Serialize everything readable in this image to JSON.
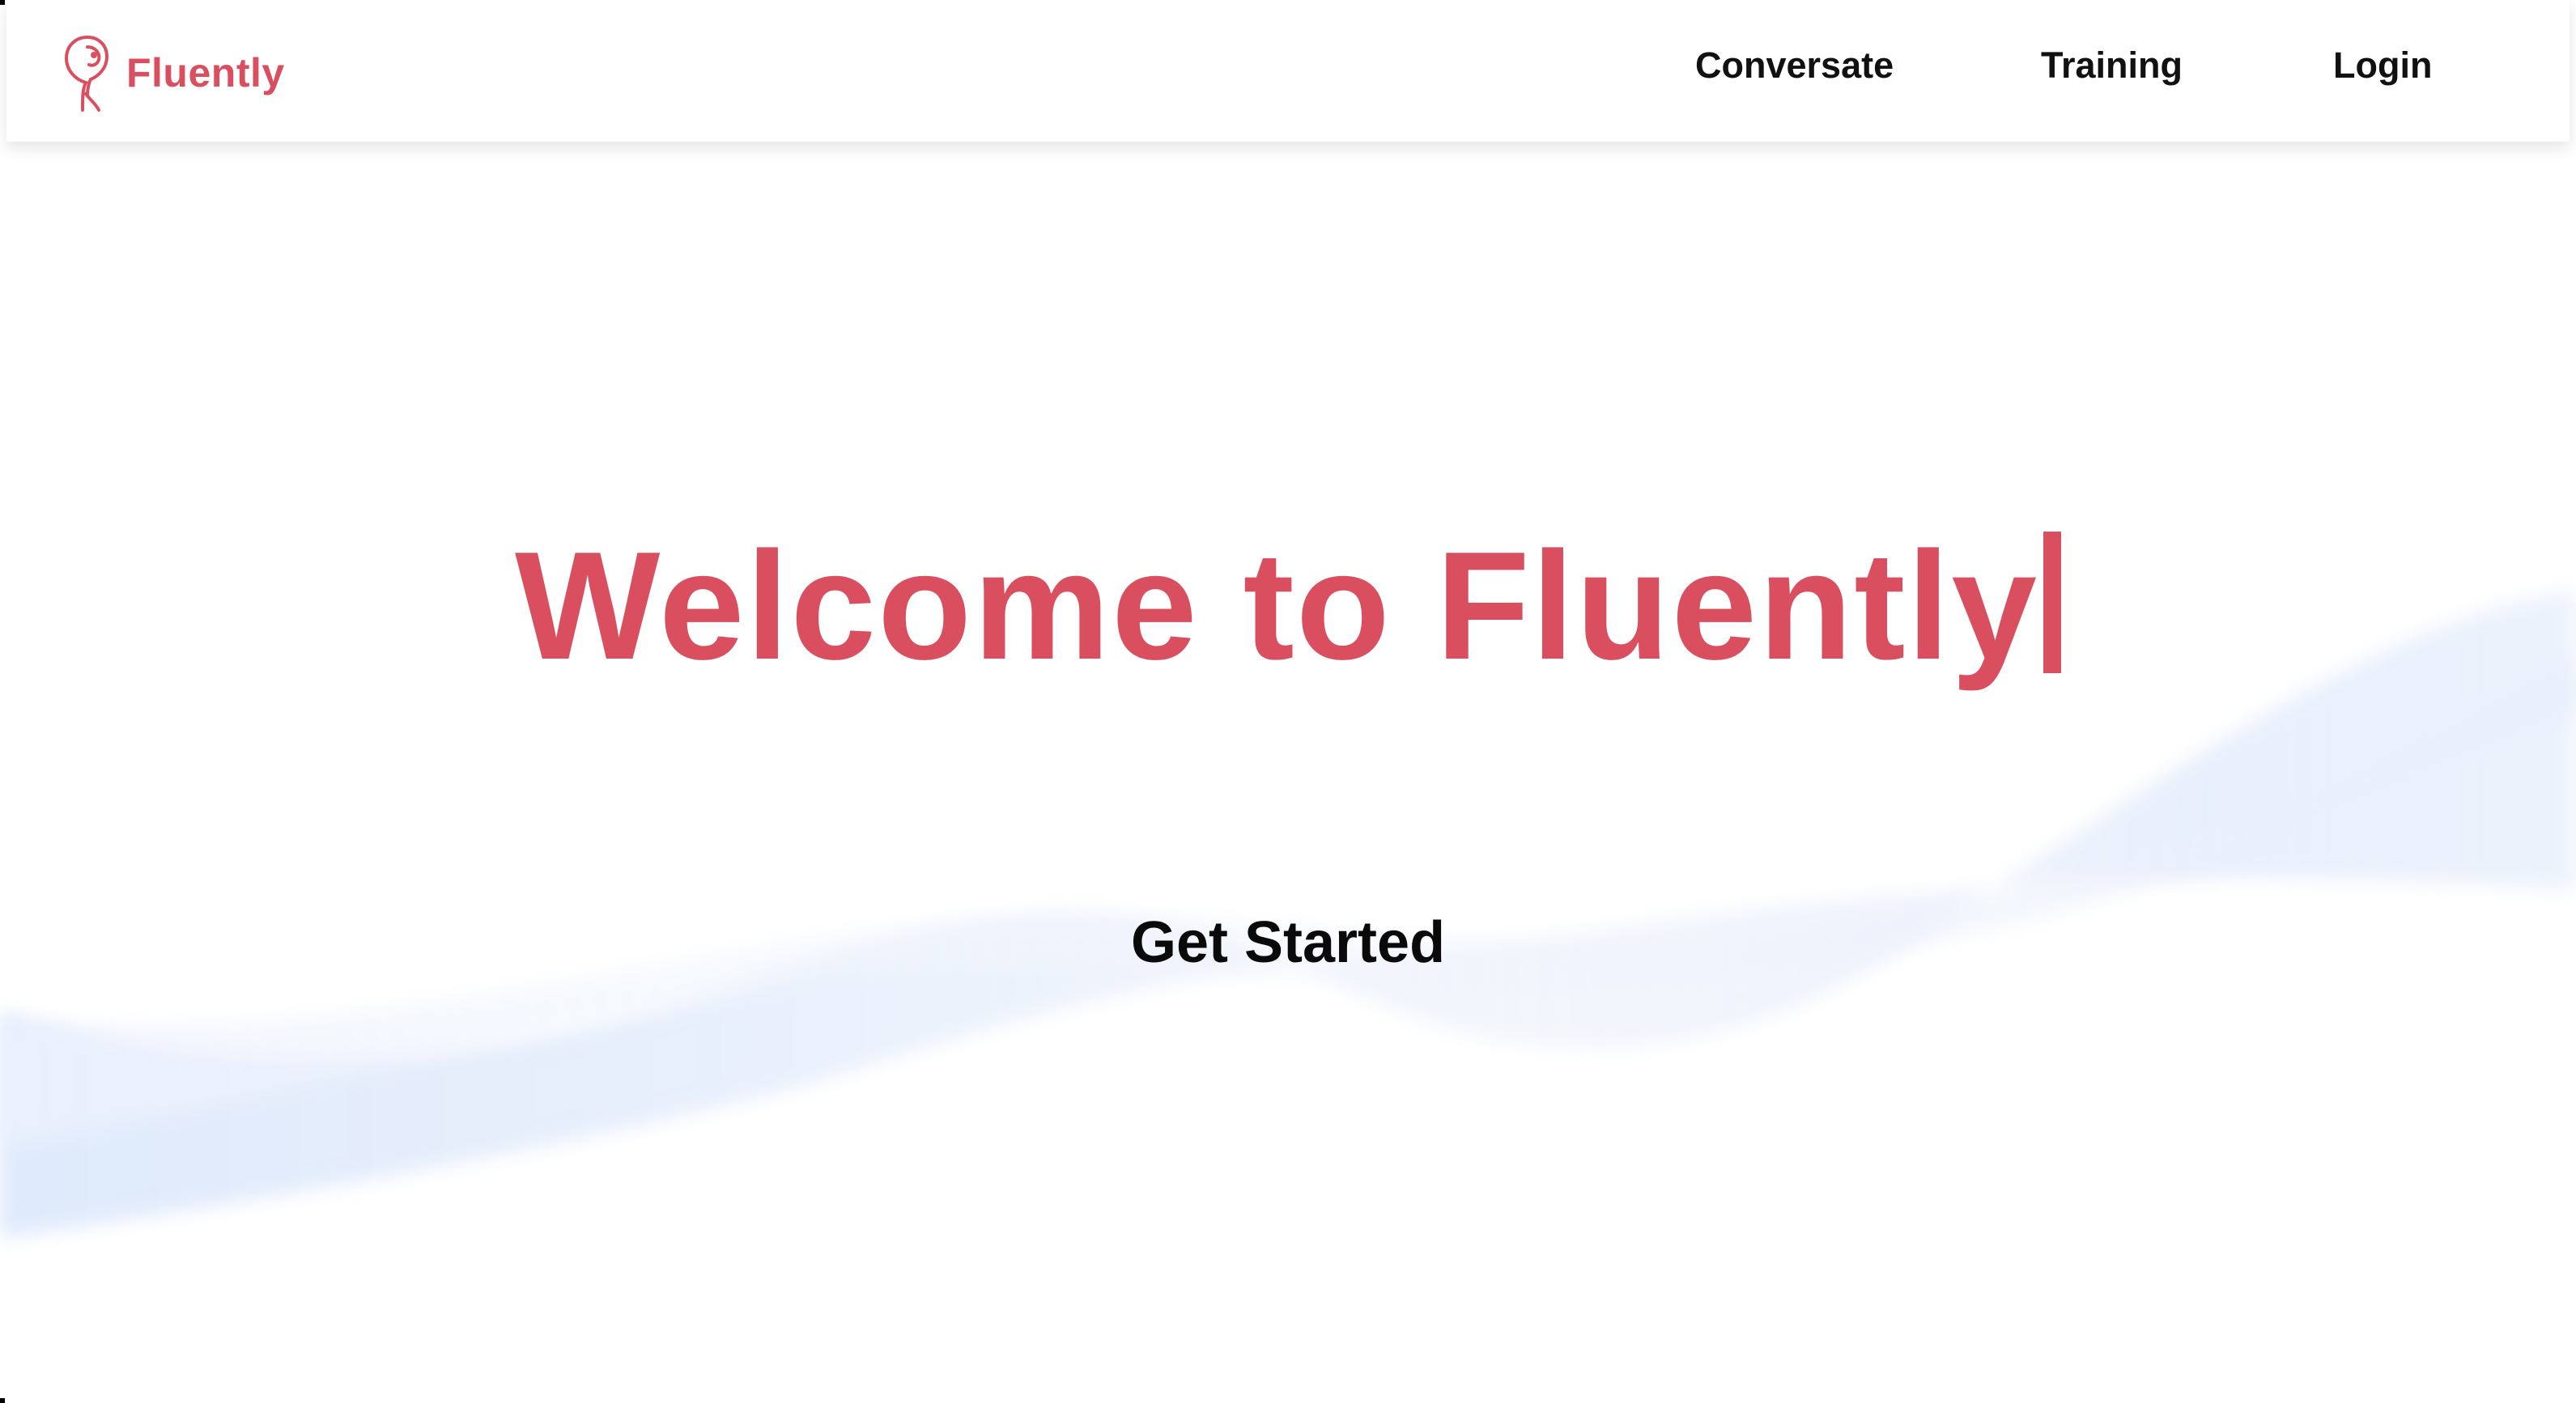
{
  "brand": {
    "name": "Fluently",
    "logo_icon": "parrot-icon",
    "color": "#d94f5f"
  },
  "nav": {
    "items": [
      {
        "label": "Conversate"
      },
      {
        "label": "Training"
      },
      {
        "label": "Login"
      }
    ]
  },
  "hero": {
    "title": "Welcome to Fluently",
    "title_color": "#d94f5f",
    "cta_label": "Get Started"
  },
  "background": {
    "wave_color": "#dfe9fb"
  }
}
